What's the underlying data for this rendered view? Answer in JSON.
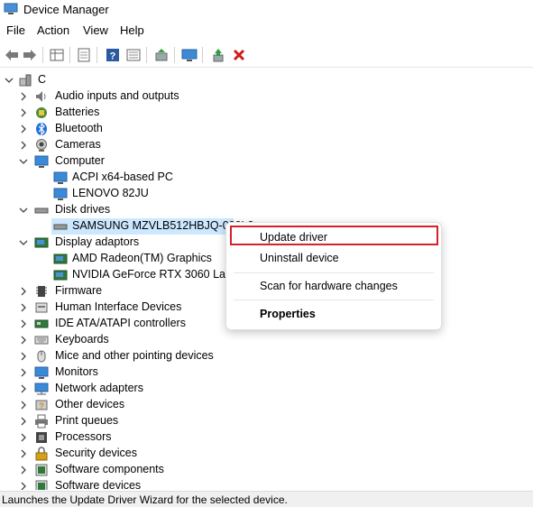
{
  "window": {
    "title": "Device Manager"
  },
  "menu": [
    "File",
    "Action",
    "View",
    "Help"
  ],
  "toolbar": {
    "buttons": [
      "back",
      "forward",
      "properties-grid",
      "show-hide",
      "help",
      "scan",
      "update-driver",
      "view-monitor",
      "enable",
      "uninstall"
    ]
  },
  "tree": {
    "root": "C",
    "categories": [
      "Audio inputs and outputs",
      "Batteries",
      "Bluetooth",
      "Cameras",
      "Computer",
      "ACPI x64-based PC",
      "LENOVO 82JU",
      "Disk drives",
      "SAMSUNG MZVLB512HBJQ-000L2",
      "Display adaptors",
      "AMD Radeon(TM) Graphics",
      "NVIDIA GeForce RTX 3060 Laptop",
      "Firmware",
      "Human Interface Devices",
      "IDE ATA/ATAPI controllers",
      "Keyboards",
      "Mice and other pointing devices",
      "Monitors",
      "Network adapters",
      "Other devices",
      "Print queues",
      "Processors",
      "Security devices",
      "Software components",
      "Software devices"
    ]
  },
  "context_menu": {
    "update_driver": "Update driver",
    "uninstall_device": "Uninstall device",
    "scan": "Scan for hardware changes",
    "properties": "Properties"
  },
  "status": "Launches the Update Driver Wizard for the selected device.",
  "colors": {
    "highlight_border": "#d6202b",
    "selection": "#cce8ff"
  }
}
